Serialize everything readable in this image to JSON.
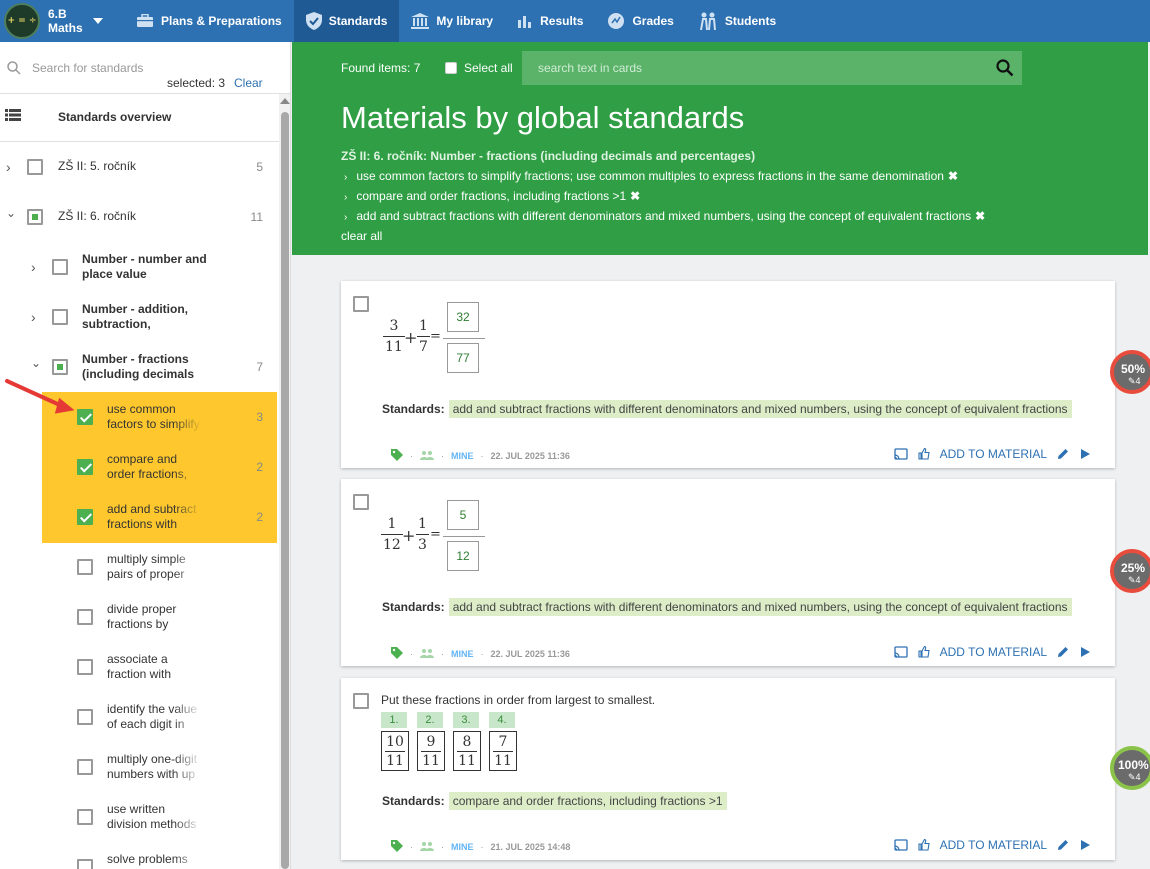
{
  "topbar": {
    "class_line1": "6.B",
    "class_line2": "Maths",
    "logo_text": "+ = ÷",
    "nav": [
      {
        "label": "Plans & Preparations",
        "icon": "briefcase-icon",
        "active": false
      },
      {
        "label": "Standards",
        "icon": "shield-check-icon",
        "active": true
      },
      {
        "label": "My library",
        "icon": "library-icon",
        "active": false
      },
      {
        "label": "Results",
        "icon": "bar-chart-icon",
        "active": false
      },
      {
        "label": "Grades",
        "icon": "grades-icon",
        "active": false
      },
      {
        "label": "Students",
        "icon": "students-icon",
        "active": false
      }
    ]
  },
  "sidebar": {
    "search_placeholder": "Search for standards",
    "selected_text": "selected: 3",
    "clear_label": "Clear",
    "overview_label": "Standards overview",
    "tree": [
      {
        "label": "ZŠ II: 5. ročník",
        "count": "5",
        "state": "unchecked",
        "level": 0,
        "expanded": false
      },
      {
        "label": "ZŠ II: 6. ročník",
        "count": "11",
        "state": "partial",
        "level": 0,
        "expanded": true
      },
      {
        "label": "Number - number and place value",
        "count": "",
        "state": "unchecked",
        "level": 1,
        "expanded": false
      },
      {
        "label": "Number - addition, subtraction,",
        "count": "",
        "state": "unchecked",
        "level": 1,
        "expanded": false
      },
      {
        "label": "Number - fractions (including decimals",
        "count": "7",
        "state": "partial",
        "level": 1,
        "expanded": true
      },
      {
        "label": "use common factors to simplify fractions",
        "count": "3",
        "state": "checked",
        "level": 2
      },
      {
        "label": "compare and order fractions, including",
        "count": "2",
        "state": "checked",
        "level": 2
      },
      {
        "label": "add and subtract fractions with different",
        "count": "2",
        "state": "checked",
        "level": 2
      },
      {
        "label": "multiply simple pairs of proper fractions",
        "count": "",
        "state": "unchecked",
        "level": 2
      },
      {
        "label": "divide proper fractions by whole numbers",
        "count": "",
        "state": "unchecked",
        "level": 2
      },
      {
        "label": "associate a fraction with division and",
        "count": "",
        "state": "unchecked",
        "level": 2
      },
      {
        "label": "identify the value of each digit in numbers",
        "count": "",
        "state": "unchecked",
        "level": 2
      },
      {
        "label": "multiply one-digit numbers with up to",
        "count": "",
        "state": "unchecked",
        "level": 2
      },
      {
        "label": "use written division methods in cases",
        "count": "",
        "state": "unchecked",
        "level": 2
      },
      {
        "label": "solve problems which",
        "count": "",
        "state": "unchecked",
        "level": 2
      }
    ]
  },
  "header": {
    "found_items": "Found items: 7",
    "select_all": "Select all",
    "search_placeholder": "search text in cards",
    "title": "Materials by global standards",
    "category": "ZŠ II: 6. ročník: Number - fractions (including decimals and percentages)",
    "standards": [
      "use common factors to simplify fractions; use common multiples to express fractions in the same denomination",
      "compare and order fractions, including fractions >1",
      "add and subtract fractions with different denominators and mixed numbers, using the concept of equivalent fractions"
    ],
    "clear_all": "clear all"
  },
  "cards": [
    {
      "frac1": {
        "n": "3",
        "d": "11"
      },
      "frac2": {
        "n": "1",
        "d": "7"
      },
      "answer": {
        "n": "32",
        "d": "77"
      },
      "standards_label": "Standards:",
      "standard": "add and subtract fractions with different denominators and mixed numbers, using the concept of equivalent fractions",
      "mine": "MINE",
      "date": "22. JUL 2025 11:36",
      "add_label": "ADD TO MATERIAL",
      "score": "50%",
      "score_sub": "4"
    },
    {
      "frac1": {
        "n": "1",
        "d": "12"
      },
      "frac2": {
        "n": "1",
        "d": "3"
      },
      "answer": {
        "n": "5",
        "d": "12"
      },
      "standards_label": "Standards:",
      "standard": "add and subtract fractions with different denominators and mixed numbers, using the concept of equivalent fractions",
      "mine": "MINE",
      "date": "22. JUL 2025 11:36",
      "add_label": "ADD TO MATERIAL",
      "score": "25%",
      "score_sub": "4"
    },
    {
      "question": "Put these fractions in order from largest to smallest.",
      "positions": [
        "1.",
        "2.",
        "3.",
        "4."
      ],
      "fractions": [
        {
          "n": "10",
          "d": "11"
        },
        {
          "n": "9",
          "d": "11"
        },
        {
          "n": "8",
          "d": "11"
        },
        {
          "n": "7",
          "d": "11"
        }
      ],
      "standards_label": "Standards:",
      "standard": "compare and order fractions, including fractions >1",
      "mine": "MINE",
      "date": "21. JUL 2025 14:48",
      "add_label": "ADD TO MATERIAL",
      "score": "100%",
      "score_sub": "4"
    }
  ]
}
